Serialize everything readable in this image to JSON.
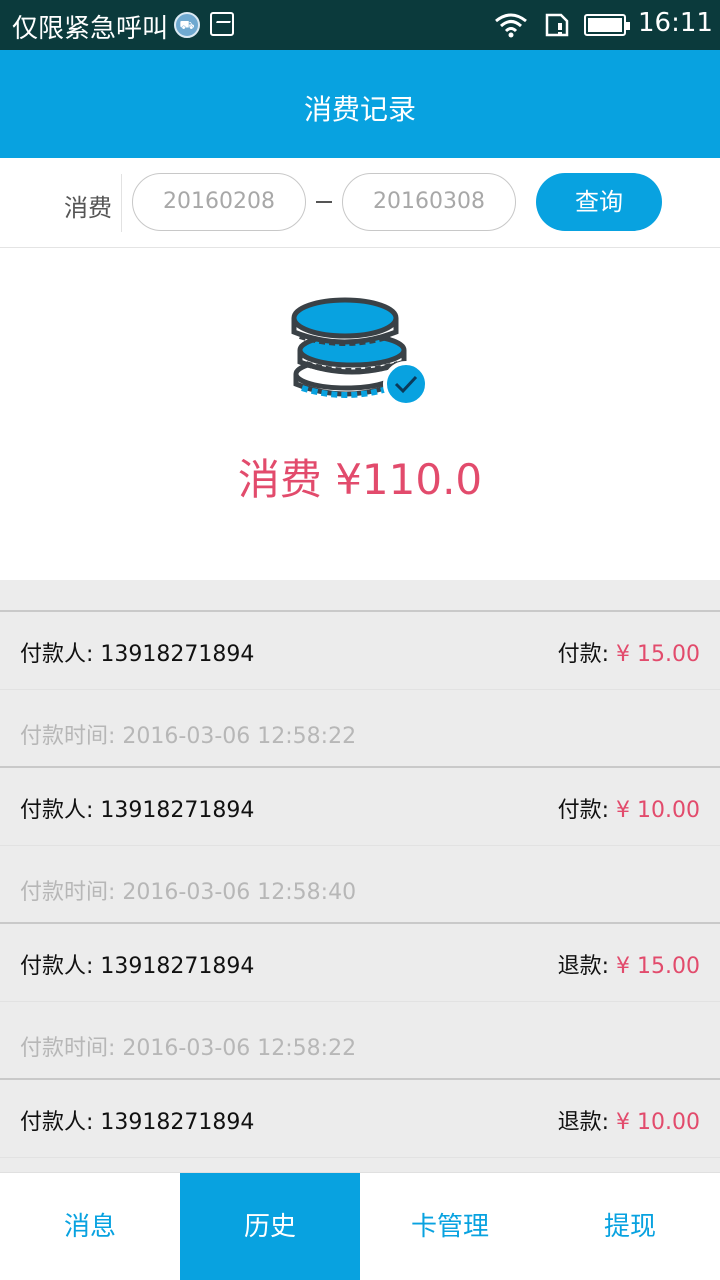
{
  "status_bar": {
    "carrier_text": "仅限紧急呼叫",
    "time": "16:11",
    "icons": [
      "railway-badge-icon",
      "image-icon",
      "wifi-icon",
      "sim-card-icon",
      "battery-icon"
    ]
  },
  "header": {
    "title": "消费记录"
  },
  "filter": {
    "label": "消费",
    "start_date": "20160208",
    "end_date": "20160308",
    "query_label": "查询"
  },
  "summary": {
    "total_text": "消费 ¥110.0"
  },
  "records": [
    {
      "payer_label": "付款人:",
      "payer": "13918271894",
      "type_label": "付款:",
      "amount": "¥ 15.00",
      "time_label": "付款时间:",
      "time": "2016-03-06 12:58:22"
    },
    {
      "payer_label": "付款人:",
      "payer": "13918271894",
      "type_label": "付款:",
      "amount": "¥ 10.00",
      "time_label": "付款时间:",
      "time": "2016-03-06 12:58:40"
    },
    {
      "payer_label": "付款人:",
      "payer": "13918271894",
      "type_label": "退款:",
      "amount": "¥ 15.00",
      "time_label": "付款时间:",
      "time": "2016-03-06 12:58:22"
    },
    {
      "payer_label": "付款人:",
      "payer": "13918271894",
      "type_label": "退款:",
      "amount": "¥ 10.00",
      "time_label": "",
      "time": ""
    }
  ],
  "tabs": [
    {
      "label": "消息",
      "active": false
    },
    {
      "label": "历史",
      "active": true
    },
    {
      "label": "卡管理",
      "active": false
    },
    {
      "label": "提现",
      "active": false
    }
  ],
  "colors": {
    "primary": "#08a2e0",
    "accent": "#e24b6c",
    "status_bar": "#0b3a3c"
  }
}
